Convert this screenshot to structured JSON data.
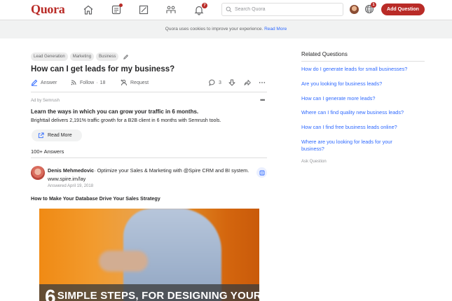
{
  "app": {
    "logo": "Quora"
  },
  "nav": {
    "notifications_count": "7",
    "search_placeholder": "Search Quora",
    "languages_count": "1",
    "add_question_label": "Add Question"
  },
  "cookie_banner": {
    "text": "Quora uses cookies to improve your experience.",
    "link": "Read More"
  },
  "question": {
    "topics": [
      "Lead Generation",
      "Marketing",
      "Business"
    ],
    "title": "How can I get leads for my business?",
    "actions": {
      "answer": "Answer",
      "follow": "Follow",
      "follow_count": "18",
      "request": "Request",
      "comments_count": "3"
    }
  },
  "ad": {
    "by": "Ad by Semrush",
    "title": "Learn the ways in which you can grow your traffic in 6 months.",
    "text": "Brighttail delivers 2,191% traffic growth for a B2B client in 6 months with Semrush tools.",
    "cta": "Read More"
  },
  "answers": {
    "count_label": "100+ Answers",
    "first": {
      "author": "Denis Mehmedovic",
      "credential": "Optimize your Sales & Marketing with @Spire CRM and BI system. www.spire.im/lay",
      "date": "Answered April 19, 2018",
      "title": "How to Make Your Database Drive Your Sales Strategy",
      "image_caption_big": "6",
      "image_caption": "SIMPLE STEPS, FOR DESIGNING YOUR"
    }
  },
  "sidebar": {
    "heading": "Related Questions",
    "links": [
      "How do I generate leads for small businesses?",
      "Are you looking for business leads?",
      "How can I generate more leads?",
      "Where can I find quality new business leads?",
      "How can I find free business leads online?",
      "Where are you looking for leads for your business?"
    ],
    "ask": "Ask Question"
  },
  "colors": {
    "brand": "#b92b27",
    "link": "#2e69ff"
  }
}
